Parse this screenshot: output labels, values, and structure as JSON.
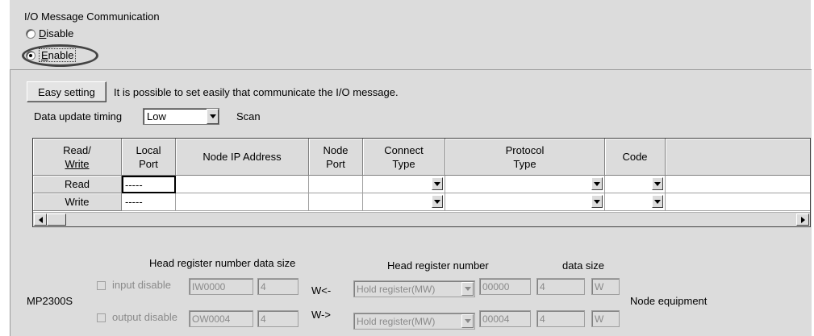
{
  "io_group": {
    "title": "I/O Message Communication",
    "disable_label": "Disable",
    "enable_label": "Enable",
    "selected": "Enable"
  },
  "toolbar": {
    "easy_setting_label": "Easy setting",
    "easy_setting_desc": "It is possible to set easily that communicate the I/O message.",
    "data_update_timing_label": "Data update timing",
    "data_update_timing_value": "Low",
    "scan_label": "Scan"
  },
  "grid": {
    "headers": {
      "read_write": [
        "Read/",
        "Write"
      ],
      "local_port": [
        "Local",
        "Port"
      ],
      "node_ip": "Node IP Address",
      "node_port": [
        "Node",
        "Port"
      ],
      "connect_type": [
        "Connect",
        "Type"
      ],
      "protocol_type": [
        "Protocol",
        "Type"
      ],
      "code": "Code"
    },
    "rows": [
      {
        "label": "Read",
        "local_port": "-----"
      },
      {
        "label": "Write",
        "local_port": "-----"
      }
    ]
  },
  "bottom": {
    "head_reg_size_label": "Head register number  data size",
    "head_reg_label": "Head register number",
    "data_size_label": "data size",
    "device_label": "MP2300S",
    "node_equipment_label": "Node equipment",
    "input": {
      "checkbox_label": "input disable",
      "register": "IW0000",
      "size": "4",
      "direction": "W<-",
      "reg_type": "Hold register(MW)",
      "node_register": "00000",
      "node_size": "4",
      "unit": "W"
    },
    "output": {
      "checkbox_label": "output disable",
      "register": "OW0004",
      "size": "4",
      "direction": "W->",
      "reg_type": "Hold register(MW)",
      "node_register": "00004",
      "node_size": "4",
      "unit": "W"
    }
  },
  "colors": {
    "panel": "#dcdcdc",
    "disabled_text": "#8a8a8a"
  }
}
